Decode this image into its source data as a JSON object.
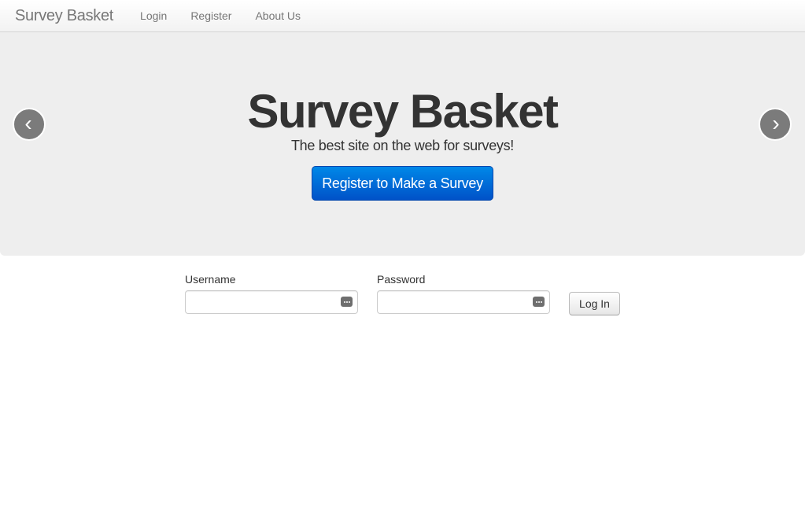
{
  "navbar": {
    "brand": "Survey Basket",
    "links": [
      "Login",
      "Register",
      "About Us"
    ]
  },
  "hero": {
    "title": "Survey Basket",
    "subtitle": "The best site on the web for surveys!",
    "cta_label": "Register to Make a Survey",
    "prev_glyph": "‹",
    "next_glyph": "›"
  },
  "login": {
    "username_label": "Username",
    "username_value": "",
    "password_label": "Password",
    "password_value": "",
    "submit_label": "Log In"
  },
  "colors": {
    "accent": "#0066d6",
    "hero_background": "#eeeeee",
    "control_background": "#7b7b7b"
  },
  "icons": {
    "carousel_prev": "chevron-left-icon",
    "carousel_next": "chevron-right-icon",
    "field_autofill": "keychain-icon"
  }
}
